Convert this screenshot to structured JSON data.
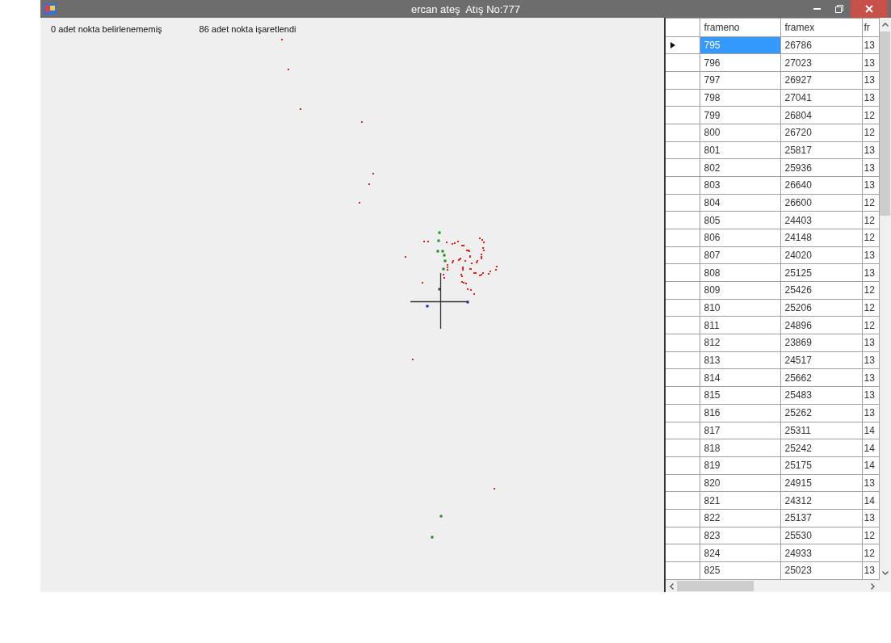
{
  "window": {
    "title": "ercan ateş  Atış No:777"
  },
  "status_labels": [
    "0 adet nokta belirlenememiş",
    "86 adet nokta işaretlendi"
  ],
  "table": {
    "columns": [
      "frameno",
      "framex",
      "fr"
    ],
    "rows": [
      {
        "cells": [
          "795",
          "26786",
          "13"
        ],
        "selected": true
      },
      {
        "cells": [
          "796",
          "27023",
          "13"
        ],
        "selected": false
      },
      {
        "cells": [
          "797",
          "26927",
          "13"
        ],
        "selected": false
      },
      {
        "cells": [
          "798",
          "27041",
          "13"
        ],
        "selected": false
      },
      {
        "cells": [
          "799",
          "26804",
          "12"
        ],
        "selected": false
      },
      {
        "cells": [
          "800",
          "26720",
          "12"
        ],
        "selected": false
      },
      {
        "cells": [
          "801",
          "25817",
          "13"
        ],
        "selected": false
      },
      {
        "cells": [
          "802",
          "25936",
          "13"
        ],
        "selected": false
      },
      {
        "cells": [
          "803",
          "26640",
          "13"
        ],
        "selected": false
      },
      {
        "cells": [
          "804",
          "26600",
          "12"
        ],
        "selected": false
      },
      {
        "cells": [
          "805",
          "24403",
          "12"
        ],
        "selected": false
      },
      {
        "cells": [
          "806",
          "24148",
          "12"
        ],
        "selected": false
      },
      {
        "cells": [
          "807",
          "24020",
          "13"
        ],
        "selected": false
      },
      {
        "cells": [
          "808",
          "25125",
          "13"
        ],
        "selected": false
      },
      {
        "cells": [
          "809",
          "25426",
          "12"
        ],
        "selected": false
      },
      {
        "cells": [
          "810",
          "25206",
          "12"
        ],
        "selected": false
      },
      {
        "cells": [
          "811",
          "24896",
          "12"
        ],
        "selected": false
      },
      {
        "cells": [
          "812",
          "23869",
          "13"
        ],
        "selected": false
      },
      {
        "cells": [
          "813",
          "24517",
          "13"
        ],
        "selected": false
      },
      {
        "cells": [
          "814",
          "25662",
          "13"
        ],
        "selected": false
      },
      {
        "cells": [
          "815",
          "25483",
          "13"
        ],
        "selected": false
      },
      {
        "cells": [
          "816",
          "25262",
          "13"
        ],
        "selected": false
      },
      {
        "cells": [
          "817",
          "25311",
          "14"
        ],
        "selected": false
      },
      {
        "cells": [
          "818",
          "25242",
          "14"
        ],
        "selected": false
      },
      {
        "cells": [
          "819",
          "25175",
          "14"
        ],
        "selected": false
      },
      {
        "cells": [
          "820",
          "24915",
          "13"
        ],
        "selected": false
      },
      {
        "cells": [
          "821",
          "24312",
          "14"
        ],
        "selected": false
      },
      {
        "cells": [
          "822",
          "25137",
          "13"
        ],
        "selected": false
      },
      {
        "cells": [
          "823",
          "25530",
          "12"
        ],
        "selected": false
      },
      {
        "cells": [
          "824",
          "24933",
          "12"
        ],
        "selected": false
      },
      {
        "cells": [
          "825",
          "25023",
          "13"
        ],
        "selected": false
      }
    ]
  }
}
